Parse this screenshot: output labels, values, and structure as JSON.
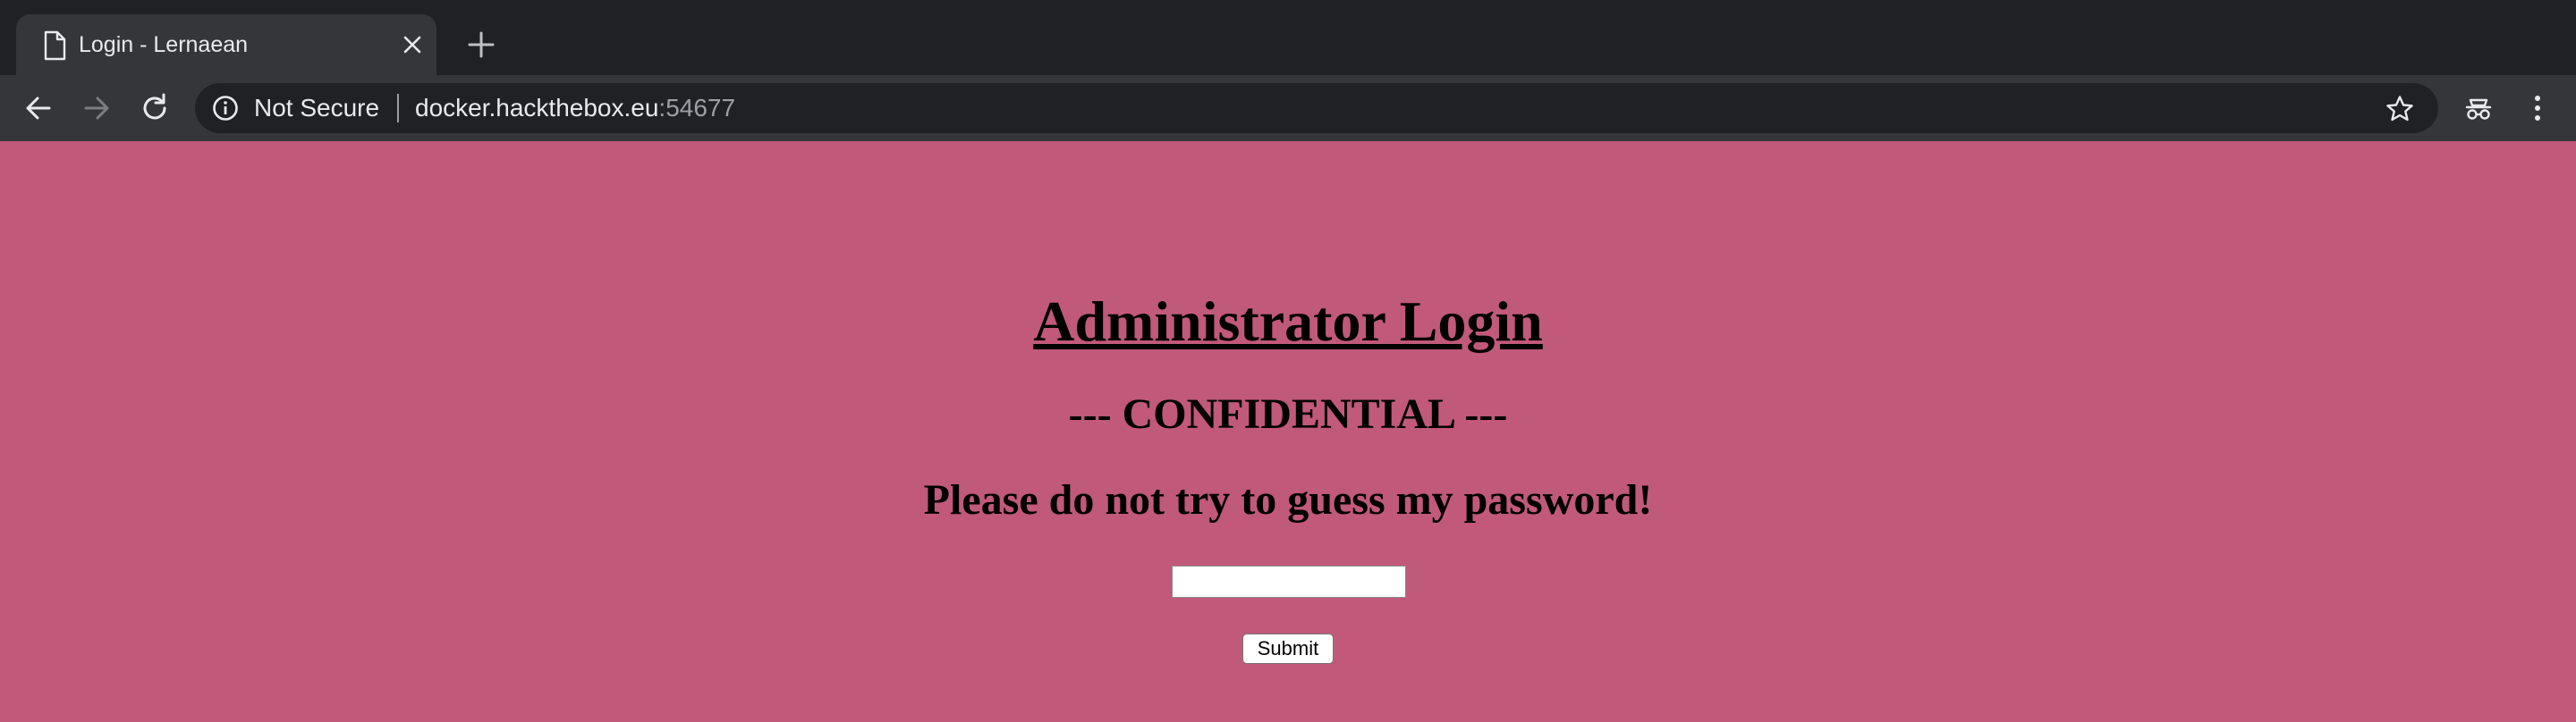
{
  "tab": {
    "title": "Login - Lernaean",
    "favicon": "document-icon"
  },
  "toolbar": {
    "security_label": "Not Secure",
    "url_host": "docker.hackthebox.eu",
    "url_port": ":54677"
  },
  "page": {
    "title": "Administrator Login",
    "subtitle": "--- CONFIDENTIAL ---",
    "warning": "Please do not try to guess my password!",
    "password_value": "",
    "submit_label": "Submit",
    "background_color": "#c0597a"
  },
  "colors": {
    "tabstrip": "#202124",
    "toolbar": "#35363a",
    "omnibox": "#202124"
  }
}
